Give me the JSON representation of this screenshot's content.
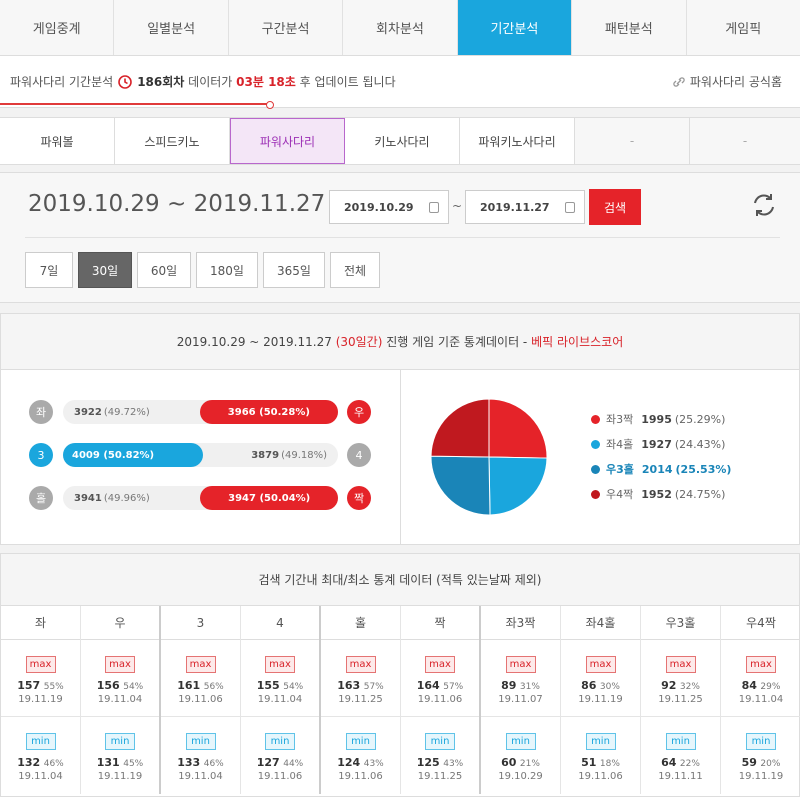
{
  "topnav": {
    "tabs": [
      "게임중계",
      "일별분석",
      "구간분석",
      "회차분석",
      "기간분석",
      "패턴분석",
      "게임픽"
    ],
    "active": 4
  },
  "info": {
    "prefix": "파워사다리 기간분석",
    "round": "186회차",
    "mid": "데이터가",
    "timer": "03분 18초",
    "suffix": "후 업데이트 됩니다",
    "official": "파워사다리 공식홈"
  },
  "game_tabs": {
    "items": [
      "파워볼",
      "스피드키노",
      "파워사다리",
      "키노사다리",
      "파워키노사다리",
      "-",
      "-"
    ],
    "active": 2
  },
  "period": {
    "range": "2019.10.29 ~ 2019.11.27",
    "from": "2019.10.29",
    "to": "2019.11.27",
    "search": "검색",
    "buttons": [
      "7일",
      "30일",
      "60일",
      "180일",
      "365일",
      "전체"
    ],
    "active": 1
  },
  "stats": {
    "header": {
      "range": "2019.10.29 ~ 2019.11.27",
      "days": "(30일간)",
      "text": "진행 게임 기준 통계데이터 -",
      "brand": "베픽 라이브스코어"
    },
    "bars": [
      {
        "left_label": "좌",
        "right_label": "우",
        "left": "3922",
        "left_pct": "(49.72%)",
        "right": "3966",
        "right_pct": "(50.28%)",
        "winner": "right",
        "color": "red",
        "frac": 0.5028
      },
      {
        "left_label": "3",
        "right_label": "4",
        "left": "4009",
        "left_pct": "(50.82%)",
        "right": "3879",
        "right_pct": "(49.18%)",
        "winner": "left",
        "color": "blue",
        "frac": 0.5082
      },
      {
        "left_label": "홀",
        "right_label": "짝",
        "left": "3941",
        "left_pct": "(49.96%)",
        "right": "3947",
        "right_pct": "(50.04%)",
        "winner": "right",
        "color": "red",
        "frac": 0.5004
      }
    ]
  },
  "chart_data": {
    "type": "pie",
    "slices": [
      {
        "label": "좌3짝",
        "value": 1995,
        "pct": "(25.29%)",
        "color": "#e52329"
      },
      {
        "label": "좌4홀",
        "value": 1927,
        "pct": "(24.43%)",
        "color": "#1aa6dd"
      },
      {
        "label": "우3홀",
        "value": 2014,
        "pct": "(25.53%)",
        "color": "#1a85b8"
      },
      {
        "label": "우4짝",
        "value": 1952,
        "pct": "(24.75%)",
        "color": "#c0191f"
      }
    ]
  },
  "minmax": {
    "header": "검색 기간내 최대/최소 통계 데이터 (적특 있는날짜 제외)",
    "max_label": "max",
    "min_label": "min",
    "columns": [
      {
        "name": "좌",
        "max": {
          "v": "157",
          "p": "55%",
          "d": "19.11.19"
        },
        "min": {
          "v": "132",
          "p": "46%",
          "d": "19.11.04"
        }
      },
      {
        "name": "우",
        "max": {
          "v": "156",
          "p": "54%",
          "d": "19.11.04"
        },
        "min": {
          "v": "131",
          "p": "45%",
          "d": "19.11.19"
        }
      },
      {
        "name": "3",
        "max": {
          "v": "161",
          "p": "56%",
          "d": "19.11.06"
        },
        "min": {
          "v": "133",
          "p": "46%",
          "d": "19.11.04"
        }
      },
      {
        "name": "4",
        "max": {
          "v": "155",
          "p": "54%",
          "d": "19.11.04"
        },
        "min": {
          "v": "127",
          "p": "44%",
          "d": "19.11.06"
        }
      },
      {
        "name": "홀",
        "max": {
          "v": "163",
          "p": "57%",
          "d": "19.11.25"
        },
        "min": {
          "v": "124",
          "p": "43%",
          "d": "19.11.06"
        }
      },
      {
        "name": "짝",
        "max": {
          "v": "164",
          "p": "57%",
          "d": "19.11.06"
        },
        "min": {
          "v": "125",
          "p": "43%",
          "d": "19.11.25"
        }
      },
      {
        "name": "좌3짝",
        "max": {
          "v": "89",
          "p": "31%",
          "d": "19.11.07"
        },
        "min": {
          "v": "60",
          "p": "21%",
          "d": "19.10.29"
        }
      },
      {
        "name": "좌4홀",
        "max": {
          "v": "86",
          "p": "30%",
          "d": "19.11.19"
        },
        "min": {
          "v": "51",
          "p": "18%",
          "d": "19.11.06"
        }
      },
      {
        "name": "우3홀",
        "max": {
          "v": "92",
          "p": "32%",
          "d": "19.11.25"
        },
        "min": {
          "v": "64",
          "p": "22%",
          "d": "19.11.11"
        }
      },
      {
        "name": "우4짝",
        "max": {
          "v": "84",
          "p": "29%",
          "d": "19.11.04"
        },
        "min": {
          "v": "59",
          "p": "20%",
          "d": "19.11.19"
        }
      }
    ]
  }
}
